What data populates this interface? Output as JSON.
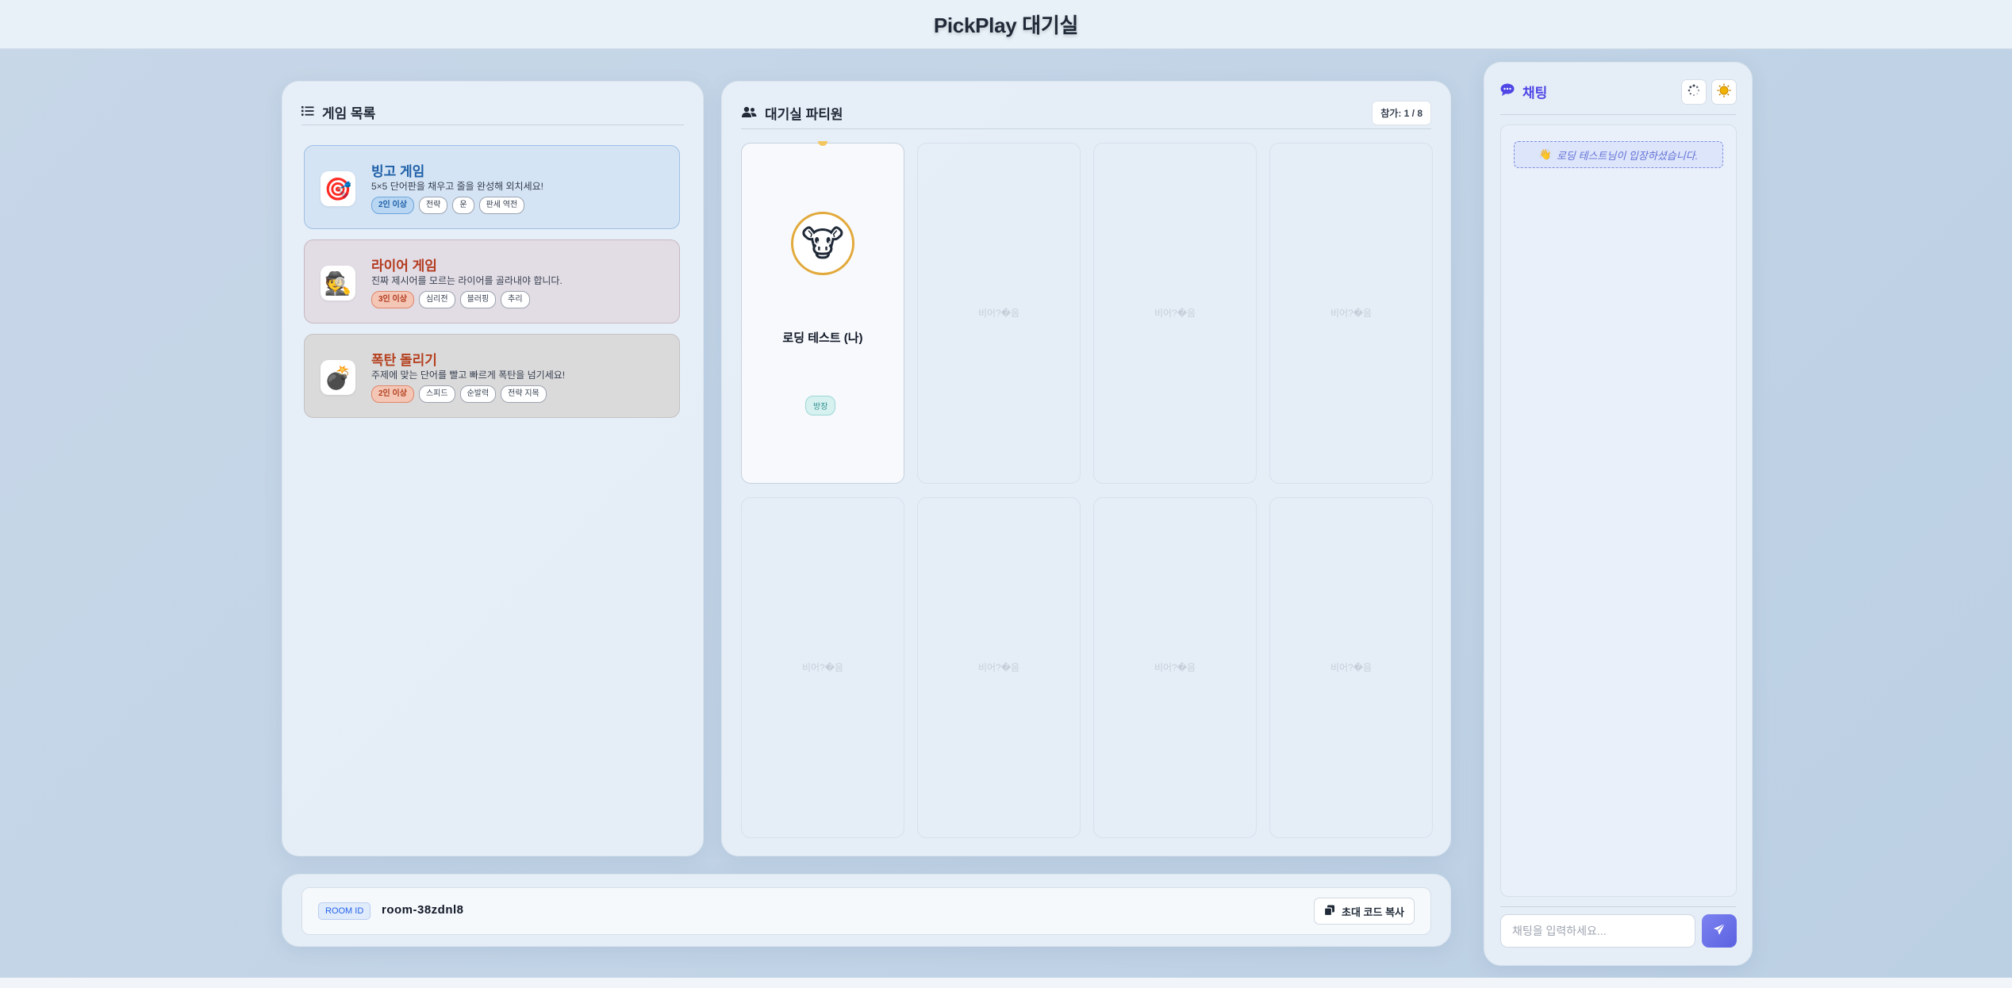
{
  "header": {
    "title": "PickPlay 대기실"
  },
  "games": {
    "title": "게임 목록",
    "title_icon": "list-icon",
    "items": [
      {
        "name": "빙고 게임",
        "icon": "target-icon",
        "description": "5×5 단어판을 채우고 줄을 완성해 외치세요!",
        "tags": [
          "2인 이상",
          "전략",
          "운",
          "판세 역전"
        ],
        "accent": "#1e5fa8",
        "bg": "#d4e4f4",
        "border": "#9fc0e3"
      },
      {
        "name": "라이어 게임",
        "icon": "spy-icon",
        "description": "진짜 제시어를 모르는 라이어를 골라내야 합니다.",
        "tags": [
          "3인 이상",
          "심리전",
          "블러핑",
          "추리"
        ],
        "accent": "#b43a1e",
        "bg": "#e2dce4",
        "border": "#c8b7c1"
      },
      {
        "name": "폭탄 돌리기",
        "icon": "bomb-icon",
        "description": "주제에 맞는 단어를 빨고 빠르게 폭탄을 넘기세요!",
        "tags": [
          "2인 이상",
          "스피드",
          "순발력",
          "전략 지목"
        ],
        "accent": "#b4401e",
        "bg": "#dbdadb",
        "border": "#c3c0c0"
      }
    ]
  },
  "party": {
    "title": "대기실 파티원",
    "title_icon": "users-icon",
    "count": "참가: 1 / 8",
    "player": {
      "name": "로딩 테스트 (나)",
      "avatar": "cow-icon",
      "badge": "방장"
    },
    "empty_label": "비어?�음"
  },
  "room": {
    "label": "ROOM ID",
    "value": "room-38zdnl8",
    "copy_label": "초대 코드 복사"
  },
  "chat": {
    "title": "채팅",
    "title_icon": "chat-icon",
    "system_message": "로딩 테스트님이 입장하셨습니다.",
    "input_placeholder": "채팅을 입력하세요..."
  }
}
